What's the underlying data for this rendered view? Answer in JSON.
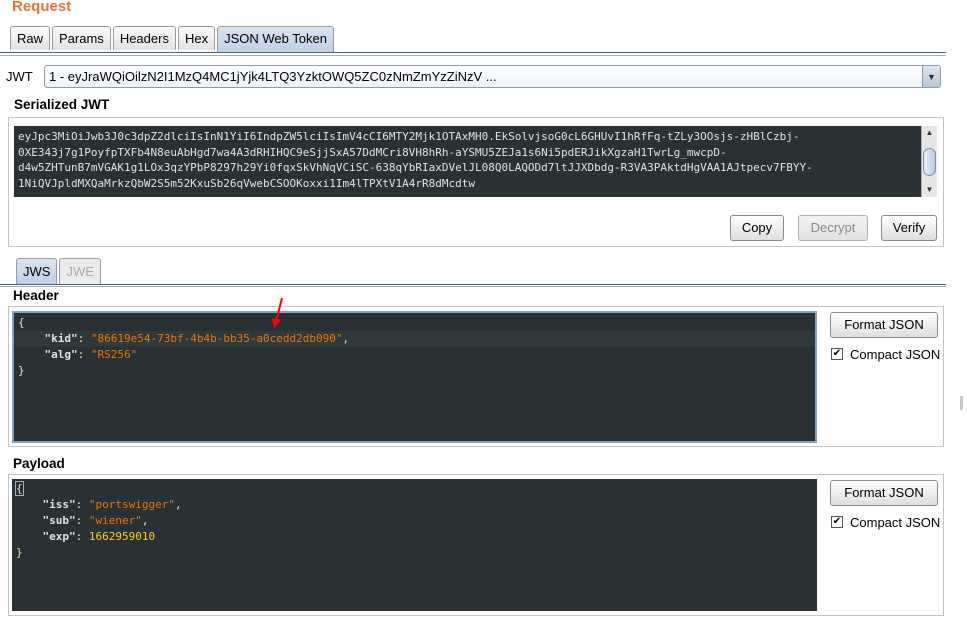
{
  "request_title": "Request",
  "tabs": [
    "Raw",
    "Params",
    "Headers",
    "Hex",
    "JSON Web Token"
  ],
  "jwt_label": "JWT",
  "jwt_select": "1 - eyJraWQiOilzN2I1MzQ4MC1jYjk4LTQ3YzktOWQ5ZC0zNmZmYzZiNzV ...",
  "serialized": {
    "title": "Serialized JWT",
    "lines": [
      "eyJpc3MiOiJwb3J0c3dpZ2dlciIsInN1YiI6IndpZW5lciIsImV4cCI6MTY2Mjk1OTAxMH0.EkSolvjsoG0cL6GHUvI1hRfFq-tZLy3OOsjs-zHBlCzbj-",
      "0XE343j7g1PoyfpTXFb4N8euAbHgd7wa4A3dRHIHQC9eSjjSxA57DdMCri8VH8hRh-aYSMU5ZEJa1s6Ni5pdERJikXgzaH1TwrLg_mwcpD-",
      "d4w5ZHTunB7mVGAK1g1LOx3qzYPbP8297h29Yi0fqxSkVhNqVCiSC-638qYbRIaxDVelJL08Q0LAQODd7ltJJXDbdg-R3VA3PAktdHgVAA1AJtpecv7FBYY-",
      "1NiQVJpldMXQaMrkzQbW2S5m52KxuSb26qVwebCSOOKoxxi1Im4lTPXtV1A4rR8dMcdtw"
    ],
    "buttons": {
      "copy": "Copy",
      "decrypt": "Decrypt",
      "verify": "Verify"
    }
  },
  "subtabs": [
    "JWS",
    "JWE"
  ],
  "header": {
    "title": "Header",
    "open": "{",
    "close": "}",
    "fields": [
      {
        "key": "\"kid\"",
        "value": "\"86619e54-73bf-4b4b-bb35-a0cedd2db090\"",
        "comma": ","
      },
      {
        "key": "\"alg\"",
        "value": "\"RS256\"",
        "comma": ""
      }
    ],
    "format_button": "Format JSON",
    "compact_label": "Compact JSON",
    "compact_checked": true
  },
  "payload": {
    "title": "Payload",
    "open": "{",
    "close": "}",
    "fields": [
      {
        "key": "\"iss\"",
        "value": "\"portswigger\"",
        "comma": ","
      },
      {
        "key": "\"sub\"",
        "value": "\"wiener\"",
        "comma": ","
      },
      {
        "key": "\"exp\"",
        "value": "1662959010",
        "comma": ""
      }
    ],
    "format_button": "Format JSON",
    "compact_label": "Compact JSON",
    "compact_checked": true
  },
  "colors": {
    "accent": "#e8733a",
    "editor_bg": "#293134",
    "string": "#ec7600",
    "number": "#ffcd22",
    "annotation": "#ff0000"
  }
}
